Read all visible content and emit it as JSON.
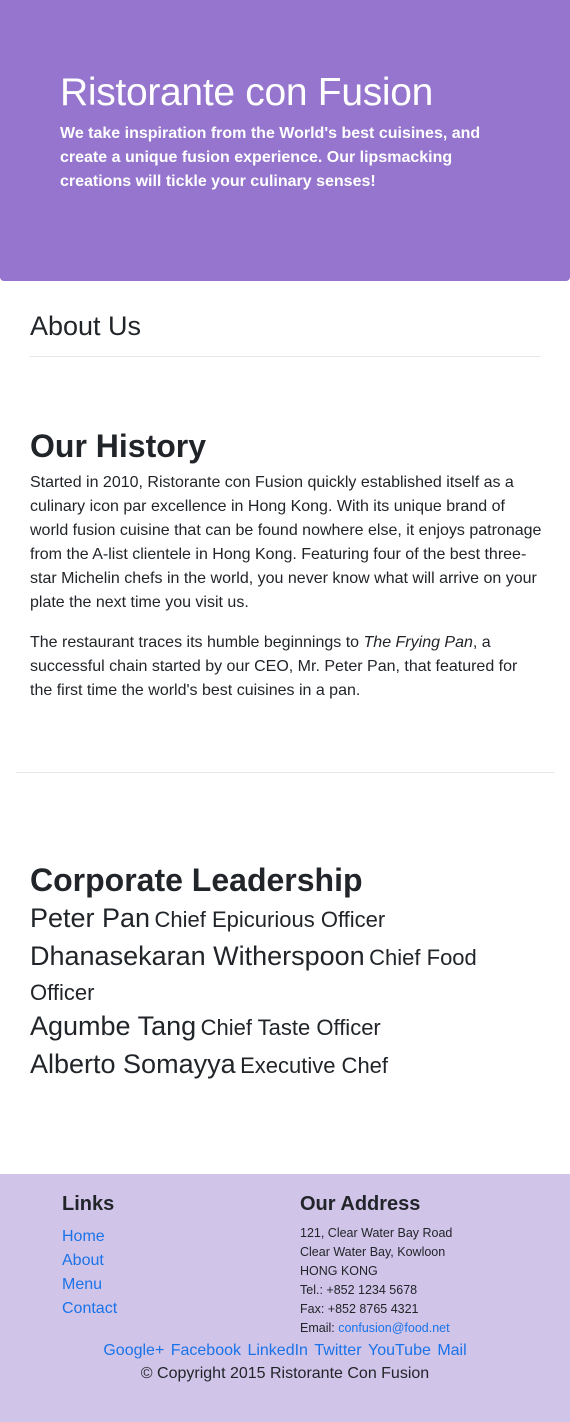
{
  "header": {
    "title": "Ristorante con Fusion",
    "description": "We take inspiration from the World's best cuisines, and create a unique fusion experience. Our lipsmacking creations will tickle your culinary senses!"
  },
  "about": {
    "title": "About Us"
  },
  "history": {
    "title": "Our History",
    "p1": "Started in 2010, Ristorante con Fusion quickly established itself as a culinary icon par excellence in Hong Kong. With its unique brand of world fusion cuisine that can be found nowhere else, it enjoys patronage from the A-list clientele in Hong Kong. Featuring four of the best three-star Michelin chefs in the world, you never know what will arrive on your plate the next time you visit us.",
    "p2_before": "The restaurant traces its humble beginnings to ",
    "p2_italic": "The Frying Pan",
    "p2_after": ", a successful chain started by our CEO, Mr. Peter Pan, that featured for the first time the world's best cuisines in a pan."
  },
  "leadership": {
    "title": "Corporate Leadership",
    "leaders": [
      {
        "name": "Peter Pan",
        "role": "Chief Epicurious Officer"
      },
      {
        "name": "Dhanasekaran Witherspoon",
        "role": "Chief Food Officer"
      },
      {
        "name": "Agumbe Tang",
        "role": "Chief Taste Officer"
      },
      {
        "name": "Alberto Somayya",
        "role": "Executive Chef"
      }
    ]
  },
  "footer": {
    "links_title": "Links",
    "links": [
      "Home",
      "About",
      "Menu",
      "Contact"
    ],
    "address_title": "Our Address",
    "address_lines": [
      "121, Clear Water Bay Road",
      "Clear Water Bay, Kowloon",
      "HONG KONG",
      "Tel.: +852 1234 5678",
      "Fax: +852 8765 4321"
    ],
    "email_label": "Email: ",
    "email": "confusion@food.net",
    "social": [
      "Google+",
      "Facebook",
      "LinkedIn",
      "Twitter",
      "YouTube",
      "Mail"
    ],
    "copyright": "© Copyright 2015 Ristorante Con Fusion"
  },
  "colors": {
    "jumbotron": "#9575cd",
    "footer": "#d1c4e9",
    "link": "#1a73e8"
  }
}
